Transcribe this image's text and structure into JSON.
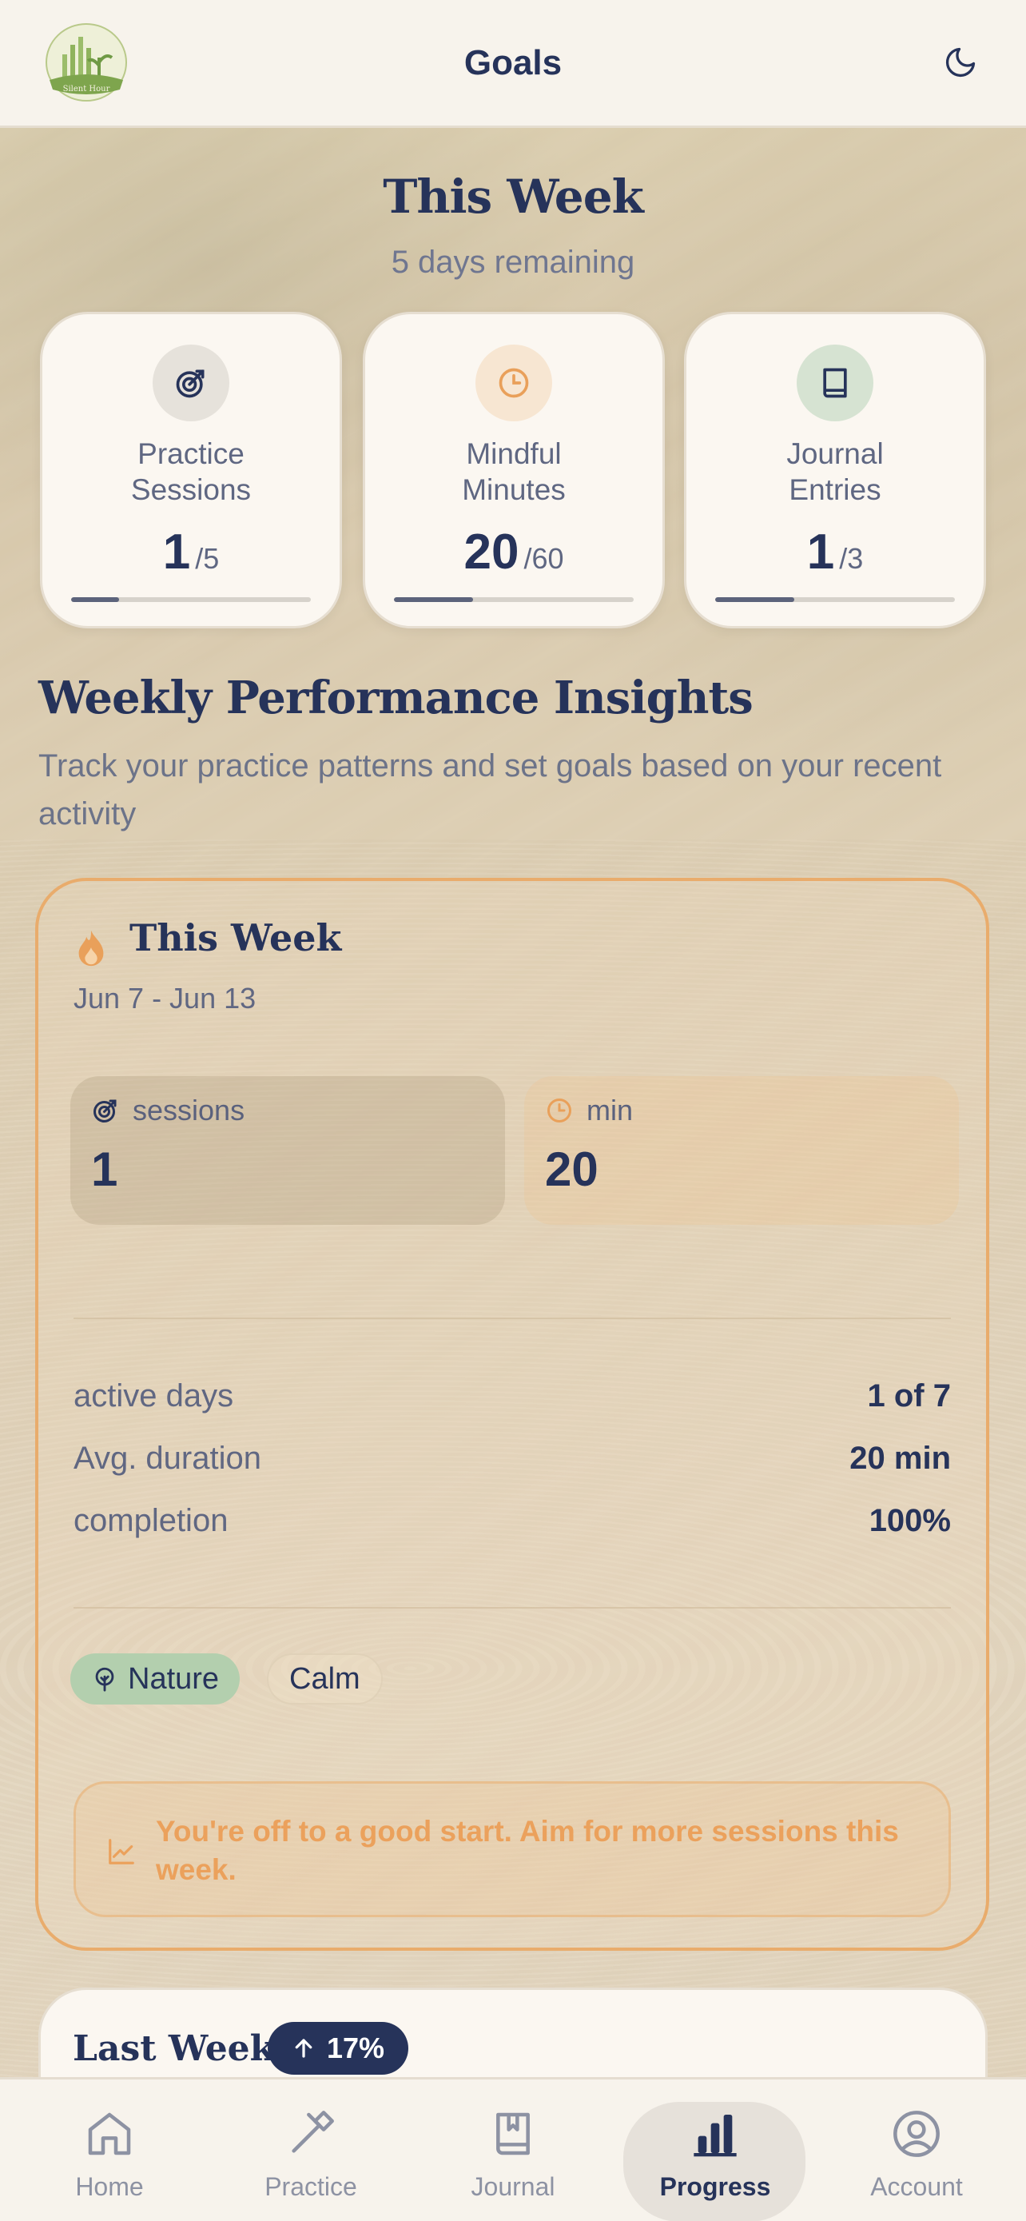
{
  "header": {
    "title": "Goals",
    "logo_text": "Silent Hour"
  },
  "this_week": {
    "title": "This Week",
    "subtitle": "5 days remaining"
  },
  "goals": [
    {
      "label_line1": "Practice",
      "label_line2": "Sessions",
      "value": "1",
      "target": "/5",
      "progress": 0.2,
      "icon": "target-icon",
      "icon_bg": "#e6e2db",
      "icon_color": "#26335a"
    },
    {
      "label_line1": "Mindful",
      "label_line2": "Minutes",
      "value": "20",
      "target": "/60",
      "progress": 0.33,
      "icon": "clock-icon",
      "icon_bg": "#f7e6d2",
      "icon_color": "#e9a05a"
    },
    {
      "label_line1": "Journal",
      "label_line2": "Entries",
      "value": "1",
      "target": "/3",
      "progress": 0.33,
      "icon": "book-icon",
      "icon_bg": "#d6e3d2",
      "icon_color": "#26335a"
    }
  ],
  "insights": {
    "title": "Weekly Performance Insights",
    "description": "Track your practice patterns and set goals based on your recent activity"
  },
  "week_panel": {
    "title": "This Week",
    "dates": "Jun 7 - Jun 13",
    "sessions_label": "sessions",
    "sessions_value": "1",
    "minutes_label": "min",
    "minutes_value": "20",
    "metrics": [
      {
        "key": "active days",
        "value": "1 of 7"
      },
      {
        "key": "Avg. duration",
        "value": "20 min"
      },
      {
        "key": "completion",
        "value": "100%"
      }
    ],
    "tags": [
      "Nature",
      "Calm"
    ],
    "tip": "You're off to a good start. Aim for more sessions this week."
  },
  "last_week": {
    "title": "Last Week",
    "badge": "17%"
  },
  "nav": {
    "items": [
      "Home",
      "Practice",
      "Journal",
      "Progress",
      "Account"
    ],
    "active": "Progress"
  },
  "colors": {
    "navy": "#26335a",
    "accent_orange": "#e9ac6c",
    "nature_green": "#b3cfae",
    "background": "#f7f3ec"
  }
}
